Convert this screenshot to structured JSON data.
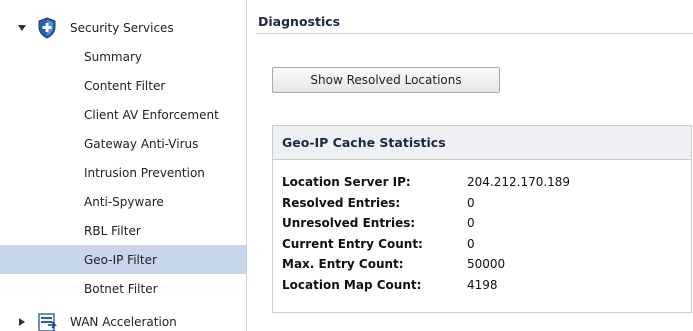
{
  "sidebar": {
    "groups": [
      {
        "label": "Security Services",
        "expanded": true,
        "icon": "shield-icon"
      },
      {
        "label": "WAN Acceleration",
        "expanded": false,
        "icon": "wan-acceleration-icon"
      }
    ],
    "items": [
      {
        "label": "Summary",
        "active": false
      },
      {
        "label": "Content Filter",
        "active": false
      },
      {
        "label": "Client AV Enforcement",
        "active": false
      },
      {
        "label": "Gateway Anti-Virus",
        "active": false
      },
      {
        "label": "Intrusion Prevention",
        "active": false
      },
      {
        "label": "Anti-Spyware",
        "active": false
      },
      {
        "label": "RBL Filter",
        "active": false
      },
      {
        "label": "Geo-IP Filter",
        "active": true
      },
      {
        "label": "Botnet Filter",
        "active": false
      }
    ]
  },
  "main": {
    "title": "Diagnostics",
    "show_resolved_button": "Show Resolved Locations",
    "panel": {
      "title": "Geo-IP Cache Statistics",
      "rows": [
        {
          "label": "Location Server IP:",
          "value": "204.212.170.189"
        },
        {
          "label": "Resolved Entries:",
          "value": "0"
        },
        {
          "label": "Unresolved Entries:",
          "value": "0"
        },
        {
          "label": "Current Entry Count:",
          "value": "0"
        },
        {
          "label": "Max. Entry Count:",
          "value": "50000"
        },
        {
          "label": "Location Map Count:",
          "value": "4198"
        }
      ]
    }
  },
  "colors": {
    "active_item_bg": "#c8d6ec",
    "panel_header_bg": "#eef0f3",
    "shield_blue": "#2c5fa8"
  }
}
